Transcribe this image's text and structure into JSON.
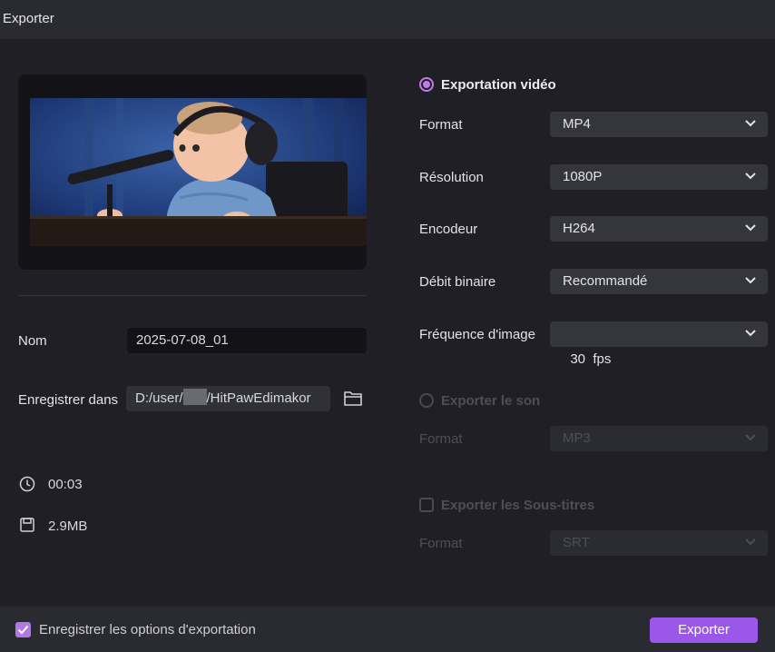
{
  "window": {
    "title": "Exporter"
  },
  "left": {
    "name_label": "Nom",
    "name_value": "2025-07-08_01",
    "save_label": "Enregistrer dans",
    "save_path_prefix": "D:/user/",
    "save_path_suffix": "/HitPawEdimakor",
    "duration": "00:03",
    "size": "2.9MB"
  },
  "video": {
    "title": "Exportation vidéo",
    "selected": true,
    "rows": [
      {
        "label": "Format",
        "value": "MP4"
      },
      {
        "label": "Résolution",
        "value": "1080P"
      },
      {
        "label": "Encodeur",
        "value": "H264"
      },
      {
        "label": "Débit binaire",
        "value": "Recommandé"
      },
      {
        "label": "Fréquence d'image",
        "value": "30  fps"
      }
    ]
  },
  "audio": {
    "title": "Exporter le son",
    "selected": false,
    "format_label": "Format",
    "format_value": "MP3"
  },
  "subtitles": {
    "title": "Exporter les Sous-titres",
    "checked": false,
    "format_label": "Format",
    "format_value": "SRT"
  },
  "footer": {
    "remember_label": "Enregistrer les options d'exportation",
    "remember_checked": true,
    "export_button": "Exporter"
  },
  "colors": {
    "accent": "#9b57e8",
    "radio": "#c07be8",
    "background": "#1f1f25"
  }
}
